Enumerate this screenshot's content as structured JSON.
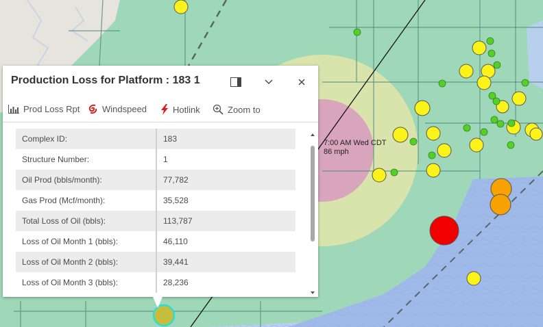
{
  "map_label": {
    "line1": "7:00 AM Wed CDT",
    "line2": "86 mph"
  },
  "popup": {
    "title": "Production Loss for Platform : 183 1",
    "actions": [
      {
        "label": "Prod Loss Rpt",
        "icon": "bar-chart-icon"
      },
      {
        "label": "Windspeed",
        "icon": "hurricane-icon"
      },
      {
        "label": "Hotlink",
        "icon": "lightning-icon"
      },
      {
        "label": "Zoom to",
        "icon": "zoom-in-icon"
      }
    ],
    "fields": [
      {
        "label": "Complex ID:",
        "value": "183"
      },
      {
        "label": "Structure Number:",
        "value": "1"
      },
      {
        "label": "Oil Prod (bbls/month):",
        "value": "77,782"
      },
      {
        "label": "Gas Prod (Mcf/month):",
        "value": "35,528"
      },
      {
        "label": "Total Loss of Oil (bbls):",
        "value": "113,787"
      },
      {
        "label": "Loss of Oil Month 1 (bbls):",
        "value": "46,110"
      },
      {
        "label": "Loss of Oil Month 2 (bbls):",
        "value": "39,441"
      },
      {
        "label": "Loss of Oil Month 3 (bbls):",
        "value": "28,236"
      }
    ]
  },
  "colors": {
    "land": "#e6e4dc",
    "green_zone": "#9fd8b8",
    "ocean": "#b8cfee",
    "deep_water": "#9fb9e8",
    "yellow_marker": "#fbf31a",
    "small_marker": "#52d227",
    "orange_marker": "#f7a200",
    "red_marker": "#f10000",
    "highlight": "#c7bd3c"
  }
}
